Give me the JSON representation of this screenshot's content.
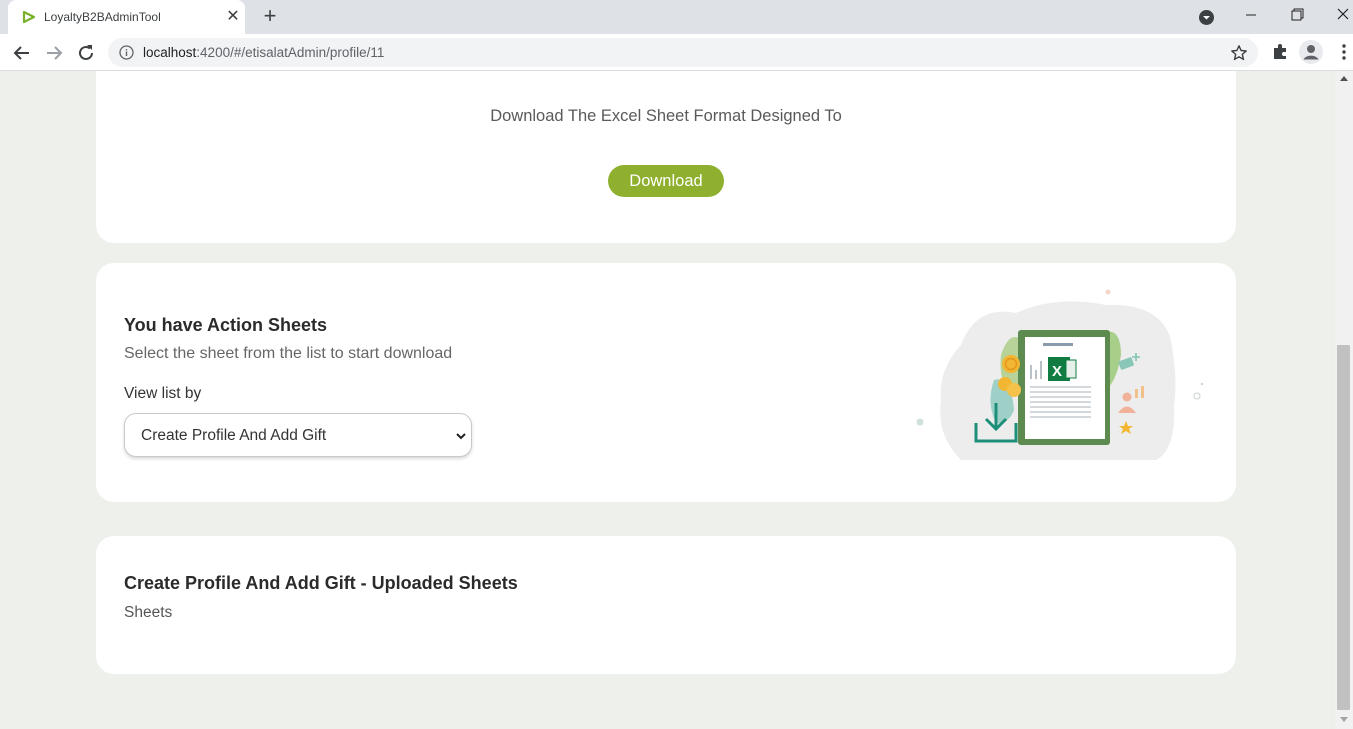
{
  "browser": {
    "tab_title": "LoyaltyB2BAdminTool",
    "url_host": "localhost",
    "url_path": ":4200/#/etisalatAdmin/profile/11"
  },
  "download_card": {
    "text": "Download The Excel Sheet Format Designed To",
    "button_label": "Download"
  },
  "actions_card": {
    "title": "You have Action Sheets",
    "subtitle": "Select the sheet from the list to start download",
    "view_label": "View list by",
    "selected_option": "Create Profile And Add Gift"
  },
  "uploaded_card": {
    "title": "Create Profile And Add Gift - Uploaded Sheets",
    "subtitle": "Sheets"
  },
  "colors": {
    "accent": "#8fb02f",
    "page_bg": "#eef0ec",
    "card_bg": "#ffffff"
  }
}
